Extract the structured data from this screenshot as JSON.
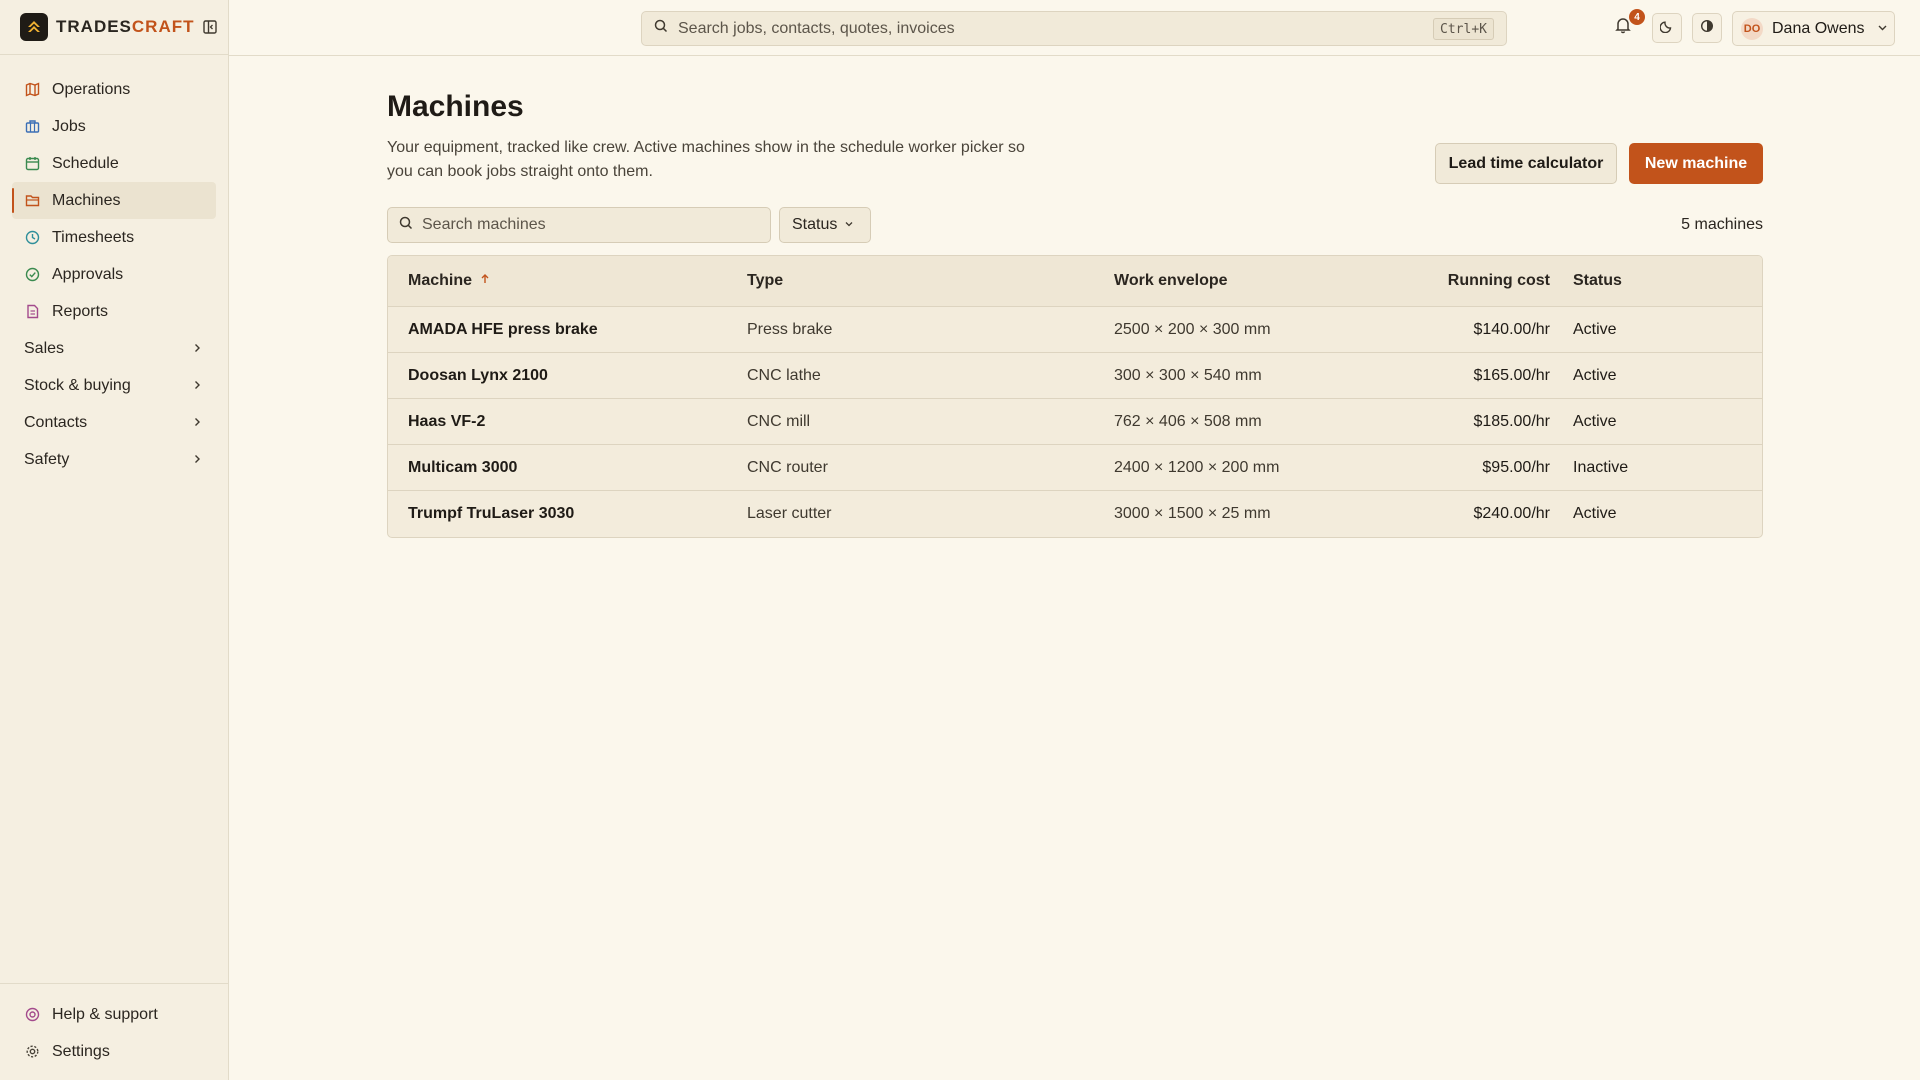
{
  "brand": {
    "name_main": "TRADES",
    "name_accent": "CRAFT"
  },
  "sidebar": {
    "items": [
      {
        "label": "Operations",
        "icon": "map-icon",
        "color": "#c2531b"
      },
      {
        "label": "Jobs",
        "icon": "briefcase-icon",
        "color": "#3b6fb6"
      },
      {
        "label": "Schedule",
        "icon": "calendar-icon",
        "color": "#3a8a4f"
      },
      {
        "label": "Machines",
        "icon": "folder-icon",
        "color": "#c2531b",
        "active": true
      },
      {
        "label": "Timesheets",
        "icon": "clock-icon",
        "color": "#2f8f9a"
      },
      {
        "label": "Approvals",
        "icon": "check-circle-icon",
        "color": "#3a8a4f"
      },
      {
        "label": "Reports",
        "icon": "document-icon",
        "color": "#a34a8c"
      }
    ],
    "groups": [
      {
        "label": "Sales"
      },
      {
        "label": "Stock & buying"
      },
      {
        "label": "Contacts"
      },
      {
        "label": "Safety"
      }
    ],
    "bottom": [
      {
        "label": "Help & support",
        "icon": "lifebuoy-icon"
      },
      {
        "label": "Settings",
        "icon": "gear-icon"
      }
    ]
  },
  "topbar": {
    "search_placeholder": "Search jobs, contacts, quotes, invoices",
    "shortcut": "Ctrl+K",
    "notification_count": "4",
    "user_initials": "DO",
    "user_name": "Dana Owens"
  },
  "page": {
    "title": "Machines",
    "description": "Your equipment, tracked like crew. Active machines show in the schedule worker picker so you can book jobs straight onto them.",
    "secondary_button": "Lead time calculator",
    "primary_button": "New machine",
    "search_placeholder": "Search machines",
    "status_filter": "Status",
    "count": "5 machines"
  },
  "table": {
    "columns": [
      "Machine",
      "Type",
      "Work envelope",
      "Running cost",
      "Status"
    ],
    "rows": [
      {
        "machine": "AMADA HFE press brake",
        "type": "Press brake",
        "envelope": "2500 × 200 × 300 mm",
        "cost": "$140.00/hr",
        "status": "Active"
      },
      {
        "machine": "Doosan Lynx 2100",
        "type": "CNC lathe",
        "envelope": "300 × 300 × 540 mm",
        "cost": "$165.00/hr",
        "status": "Active"
      },
      {
        "machine": "Haas VF-2",
        "type": "CNC mill",
        "envelope": "762 × 406 × 508 mm",
        "cost": "$185.00/hr",
        "status": "Active"
      },
      {
        "machine": "Multicam 3000",
        "type": "CNC router",
        "envelope": "2400 × 1200 × 200 mm",
        "cost": "$95.00/hr",
        "status": "Inactive"
      },
      {
        "machine": "Trumpf TruLaser 3030",
        "type": "Laser cutter",
        "envelope": "3000 × 1500 × 25 mm",
        "cost": "$240.00/hr",
        "status": "Active"
      }
    ]
  },
  "colors": {
    "accent": "#c2531b",
    "background": "#fbf7ec",
    "sidebar": "#f5efe1"
  }
}
